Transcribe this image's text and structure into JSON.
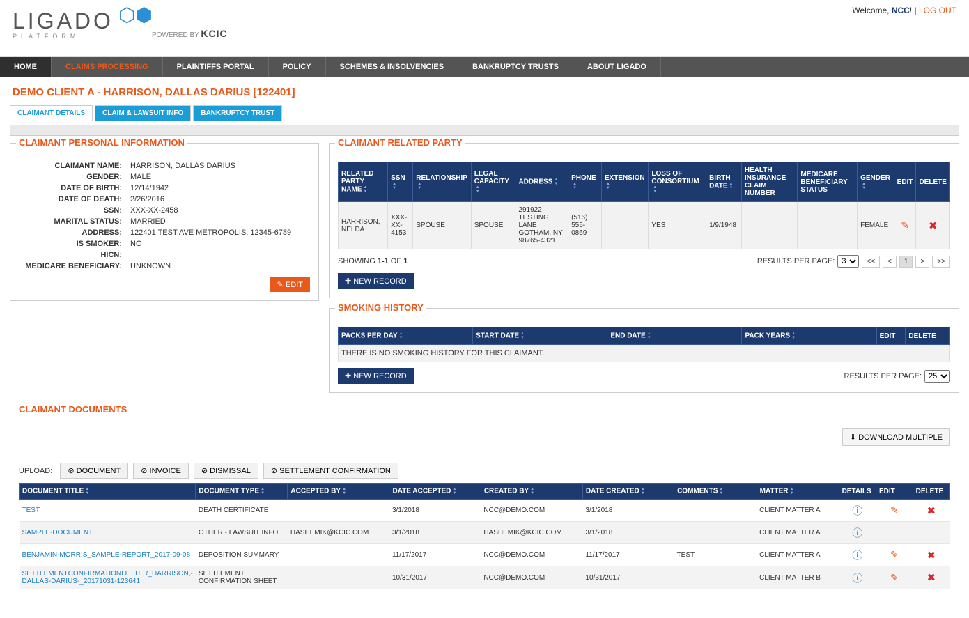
{
  "header": {
    "welcome_prefix": "Welcome, ",
    "user": "NCC",
    "exclaim": "!",
    "sep": " | ",
    "logout": "LOG OUT",
    "logo_text": "LIGADO",
    "platform": "PLATFORM",
    "powered": "POWERED BY ",
    "kcic": "KCIC"
  },
  "nav": {
    "items": [
      "HOME",
      "CLAIMS PROCESSING",
      "PLAINTIFFS PORTAL",
      "POLICY",
      "SCHEMES & INSOLVENCIES",
      "BANKRUPTCY TRUSTS",
      "ABOUT LIGADO"
    ]
  },
  "page_title": "DEMO CLIENT A - HARRISON, DALLAS DARIUS [122401]",
  "tabs": {
    "a": "CLAIMANT DETAILS",
    "b": "CLAIM & LAWSUIT INFO",
    "c": "BANKRUPTCY TRUST"
  },
  "sections": {
    "personal": "CLAIMANT PERSONAL INFORMATION",
    "related": "CLAIMANT RELATED PARTY",
    "smoking": "SMOKING HISTORY",
    "docs": "CLAIMANT DOCUMENTS"
  },
  "personal": {
    "labels": {
      "name": "CLAIMANT NAME:",
      "gender": "GENDER:",
      "dob": "DATE OF BIRTH:",
      "dod": "DATE OF DEATH:",
      "ssn": "SSN:",
      "marital": "MARITAL STATUS:",
      "address": "ADDRESS:",
      "smoker": "IS SMOKER:",
      "hicn": "HICN:",
      "medicare": "MEDICARE BENEFICIARY:"
    },
    "values": {
      "name": "HARRISON, DALLAS DARIUS",
      "gender": "MALE",
      "dob": "12/14/1942",
      "dod": "2/26/2016",
      "ssn": "XXX-XX-2458",
      "marital": "MARRIED",
      "address": "122401 TEST AVE METROPOLIS, 12345-6789",
      "smoker": "NO",
      "hicn": "",
      "medicare": "UNKNOWN"
    },
    "edit": "EDIT"
  },
  "related": {
    "cols": [
      "RELATED PARTY NAME",
      "SSN",
      "RELATIONSHIP",
      "LEGAL CAPACITY",
      "ADDRESS",
      "PHONE",
      "EXTENSION",
      "LOSS OF CONSORTIUM",
      "BIRTH DATE",
      "HEALTH INSURANCE CLAIM NUMBER",
      "MEDICARE BENEFICIARY STATUS",
      "GENDER",
      "EDIT",
      "DELETE"
    ],
    "row": {
      "name": "HARRISON, NELDA",
      "ssn": "XXX-XX-4153",
      "rel": "SPOUSE",
      "cap": "SPOUSE",
      "addr": "291922 TESTING LANE GOTHAM, NY 98765-4321",
      "phone": "(516) 555-0869",
      "ext": "",
      "loss": "YES",
      "birth": "1/9/1948",
      "hicn": "",
      "med": "",
      "gender": "FEMALE"
    },
    "showing_pre": "SHOWING ",
    "showing_range": "1-1",
    "showing_of": " OF ",
    "showing_total": "1",
    "rpp_label": "RESULTS PER PAGE:",
    "rpp_val": "3",
    "page": "1",
    "new_rec": "NEW RECORD"
  },
  "smoking": {
    "cols": [
      "PACKS PER DAY",
      "START DATE",
      "END DATE",
      "PACK YEARS",
      "EDIT",
      "DELETE"
    ],
    "empty": "THERE IS NO SMOKING HISTORY FOR THIS CLAIMANT.",
    "new_rec": "NEW RECORD",
    "rpp_label": "RESULTS PER PAGE:",
    "rpp_val": "25"
  },
  "docs": {
    "download": "DOWNLOAD MULTIPLE",
    "upload_label": "UPLOAD:",
    "upload_btns": [
      "DOCUMENT",
      "INVOICE",
      "DISMISSAL",
      "SETTLEMENT CONFIRMATION"
    ],
    "cols": [
      "DOCUMENT TITLE",
      "DOCUMENT TYPE",
      "ACCEPTED BY",
      "DATE ACCEPTED",
      "CREATED BY",
      "DATE CREATED",
      "COMMENTS",
      "MATTER",
      "DETAILS",
      "EDIT",
      "DELETE"
    ],
    "rows": [
      {
        "title": "TEST",
        "type": "DEATH CERTIFICATE",
        "acc_by": "",
        "acc_date": "3/1/2018",
        "cby": "NCC@DEMO.COM",
        "cdate": "3/1/2018",
        "comments": "",
        "matter": "CLIENT MATTER A",
        "edit": true,
        "del": true
      },
      {
        "title": "SAMPLE-DOCUMENT",
        "type": "OTHER - LAWSUIT INFO",
        "acc_by": "HASHEMIK@KCIC.COM",
        "acc_date": "3/1/2018",
        "cby": "HASHEMIK@KCIC.COM",
        "cdate": "3/1/2018",
        "comments": "",
        "matter": "CLIENT MATTER A",
        "edit": false,
        "del": false
      },
      {
        "title": "BENJAMIN-MORRIS_SAMPLE-REPORT_2017-09-08",
        "type": "DEPOSITION SUMMARY",
        "acc_by": "",
        "acc_date": "11/17/2017",
        "cby": "NCC@DEMO.COM",
        "cdate": "11/17/2017",
        "comments": "TEST",
        "matter": "CLIENT MATTER A",
        "edit": true,
        "del": true
      },
      {
        "title": "SETTLEMENTCONFIRMATIONLETTER_HARRISON,-DALLAS-DARIUS-_20171031-123641",
        "type": "SETTLEMENT CONFIRMATION SHEET",
        "acc_by": "",
        "acc_date": "10/31/2017",
        "cby": "NCC@DEMO.COM",
        "cdate": "10/31/2017",
        "comments": "",
        "matter": "CLIENT MATTER B",
        "edit": true,
        "del": true
      }
    ]
  }
}
